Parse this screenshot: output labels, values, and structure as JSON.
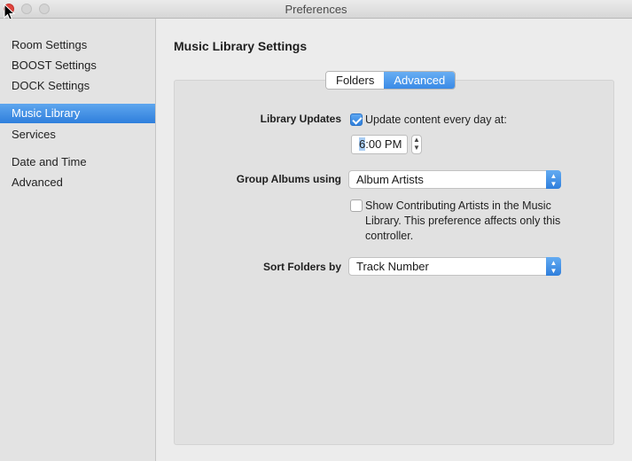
{
  "window": {
    "title": "Preferences"
  },
  "sidebar": {
    "items": [
      {
        "label": "Room Settings"
      },
      {
        "label": "BOOST Settings"
      },
      {
        "label": "DOCK Settings"
      },
      {
        "label": "Music Library",
        "selected": true
      },
      {
        "label": "Services"
      },
      {
        "label": "Date and Time"
      },
      {
        "label": "Advanced"
      }
    ]
  },
  "main": {
    "title": "Music Library Settings",
    "tabs": [
      {
        "label": "Folders"
      },
      {
        "label": "Advanced",
        "active": true
      }
    ],
    "library_updates": {
      "label": "Library Updates",
      "checkbox_label": "Update content every day at:",
      "checked": true,
      "time": "6:00 PM",
      "time_highlight": "6",
      "time_rest": ":00 PM"
    },
    "group_albums": {
      "label": "Group Albums using",
      "value": "Album Artists"
    },
    "contributing": {
      "checked": false,
      "line1": "Show Contributing Artists in the Music",
      "line2": "Library. This preference affects only this",
      "line3": "controller."
    },
    "sort_folders": {
      "label": "Sort Folders by",
      "value": "Track Number"
    }
  },
  "colors": {
    "accent": "#3a8ae6",
    "close": "#e0443e"
  },
  "icons": {
    "stepper": "chevron-up-down-icon",
    "cursor": "pointer-cursor-icon"
  }
}
